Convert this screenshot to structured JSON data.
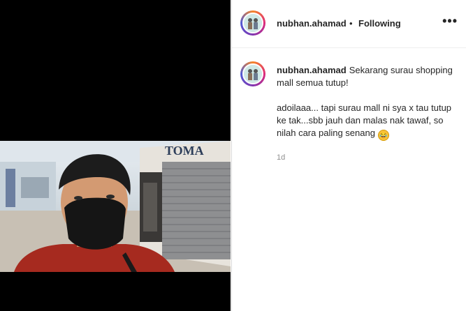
{
  "post": {
    "username": "nubhan.ahamad",
    "separator": "•",
    "follow_status": "Following",
    "more_glyph": "•••",
    "caption_line1": "Sekarang surau shopping mall semua tutup!",
    "caption_line2": "adoilaaa... tapi surau mall ni sya x tau tutup ke tak...sbb jauh dan malas nak tawaf, so nilah cara paling senang",
    "emoji": "🤣",
    "time_ago": "1d"
  },
  "media": {
    "sign_text": "TOMA"
  },
  "icons": {
    "avatar": "profile-avatar-icon",
    "more": "more-options-icon",
    "emoji": "rofl-emoji-icon"
  }
}
